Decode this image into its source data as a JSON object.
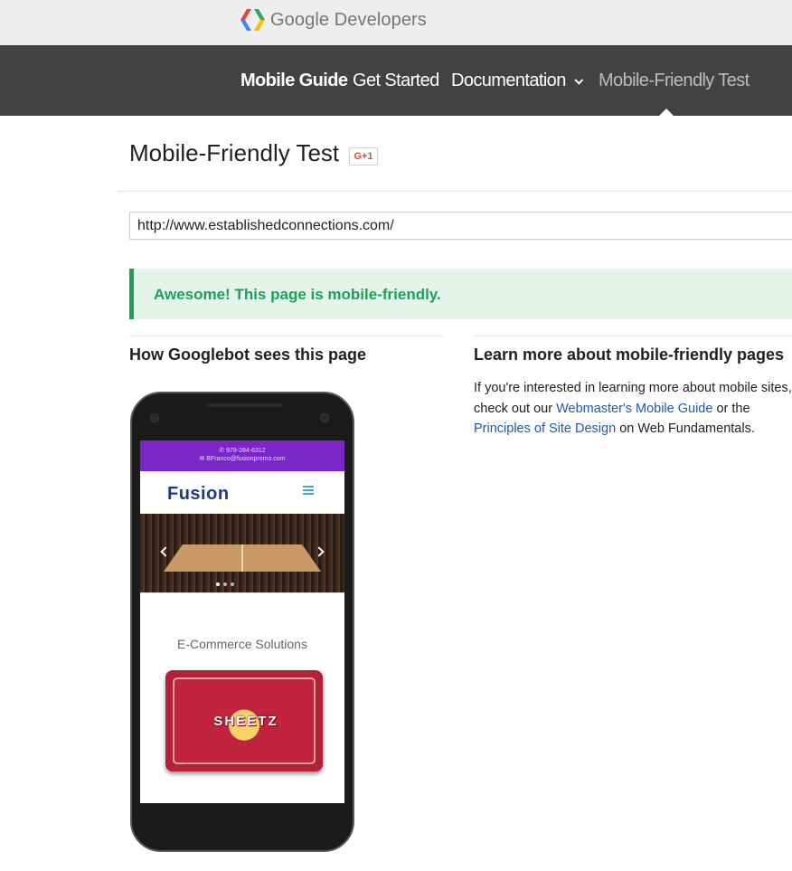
{
  "brand": {
    "name": "Google Developers"
  },
  "nav": {
    "items": [
      {
        "label": "Mobile Guide"
      },
      {
        "label": "Get Started"
      },
      {
        "label": "Documentation"
      },
      {
        "label": "Mobile-Friendly Test"
      }
    ],
    "active": "Mobile-Friendly Test"
  },
  "page": {
    "title": "Mobile-Friendly Test",
    "gplus_label": "G+1"
  },
  "url_input": {
    "value": "http://www.establishedconnections.com/"
  },
  "result": {
    "message": "Awesome! This page is mobile-friendly."
  },
  "left_col": {
    "heading": "How Googlebot sees this page"
  },
  "right_col": {
    "heading": "Learn more about mobile-friendly pages",
    "text_1": "If you're interested in learning more about mobile sites, check out our ",
    "link_1": "Webmaster's Mobile Guide",
    "text_2": " or the ",
    "link_2": "Principles of Site Design",
    "text_3": " on Web Fundamentals."
  },
  "preview": {
    "phone_line": "✆ 978-284-6312",
    "email_line": "✉ BFranco@fusionpromo.com",
    "logo": "Fusion",
    "card_title": "E-Commerce Solutions",
    "giftcard_text": "SHEETZ"
  },
  "colors": {
    "nav_bg": "#424242",
    "success_green": "#1e9e57",
    "success_bg": "#e5f4ea",
    "link_blue": "#1c58b5",
    "preview_purple": "#7b27c7"
  }
}
